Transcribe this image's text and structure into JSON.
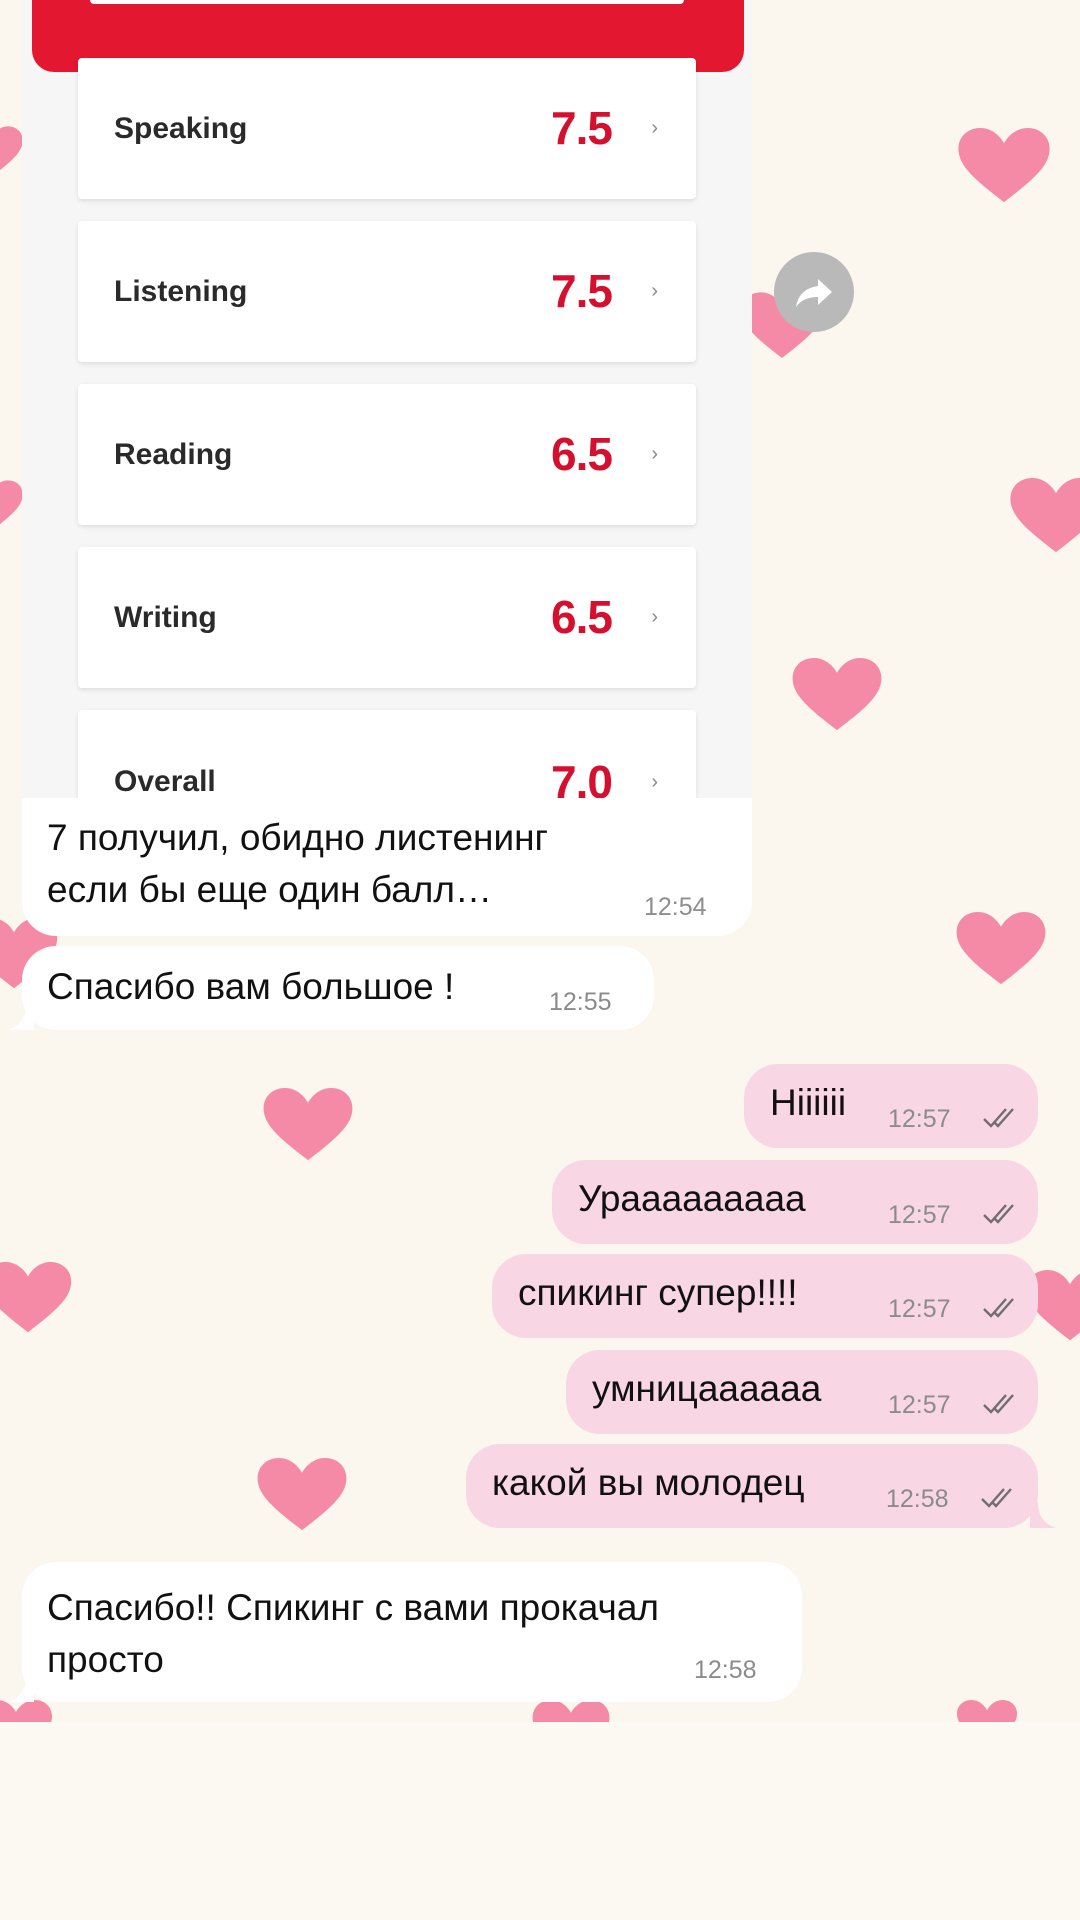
{
  "score_screenshot": {
    "scores": [
      {
        "label": "Speaking",
        "value": "7.5"
      },
      {
        "label": "Listening",
        "value": "7.5"
      },
      {
        "label": "Reading",
        "value": "6.5"
      },
      {
        "label": "Writing",
        "value": "6.5"
      },
      {
        "label": "Overall",
        "value": "7.0"
      }
    ],
    "chevron": "›"
  },
  "messages": [
    {
      "direction": "incoming",
      "text_line1": "7 получил, обидно листенинг",
      "text_line2": "если бы еще один балл…",
      "time": "12:54"
    },
    {
      "direction": "incoming",
      "text": "Спасибо вам большое !",
      "time": "12:55"
    },
    {
      "direction": "outgoing",
      "text": "Hiiiiii",
      "time": "12:57",
      "status_icon": "double-check-icon"
    },
    {
      "direction": "outgoing",
      "text": "Урааааааааа",
      "time": "12:57",
      "status_icon": "double-check-icon"
    },
    {
      "direction": "outgoing",
      "text": "спикинг супер!!!!",
      "time": "12:57",
      "status_icon": "double-check-icon"
    },
    {
      "direction": "outgoing",
      "text": "умницаааааа",
      "time": "12:57",
      "status_icon": "double-check-icon"
    },
    {
      "direction": "outgoing",
      "text": "какой вы молодец",
      "time": "12:58",
      "status_icon": "double-check-icon"
    },
    {
      "direction": "incoming",
      "text_line1": "Спасибо!! Спикинг с вами прокачал",
      "text_line2": "просто",
      "time": "12:58"
    }
  ],
  "colors": {
    "wallpaper": "#fbf6ee",
    "heart": "#f58aa7",
    "outgoing_bubble": "#f9d6e4",
    "incoming_bubble": "#ffffff",
    "score_red": "#d5102e"
  },
  "icons": {
    "forward": "forward-share-icon",
    "read_receipt": "double-check-icon",
    "wallpaper_pattern": "heart-icon"
  }
}
